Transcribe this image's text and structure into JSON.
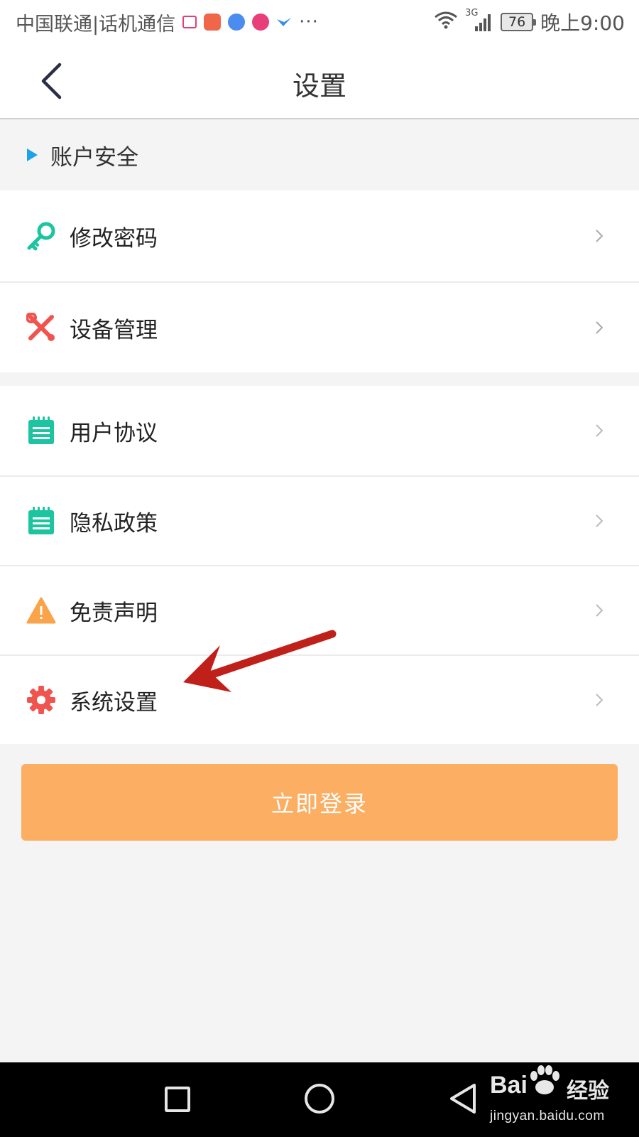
{
  "status_bar": {
    "carrier": "中国联通|话机通信",
    "more": "···",
    "network": "3G",
    "battery": "76",
    "time": "晚上9:00"
  },
  "header": {
    "title": "设置"
  },
  "section": {
    "label": "账户安全"
  },
  "menu_group_1": [
    {
      "label": "修改密码",
      "icon": "key-icon",
      "icon_color": "#1cc4a0"
    },
    {
      "label": "设备管理",
      "icon": "tools-icon",
      "icon_color": "#f0544f"
    }
  ],
  "menu_group_2": [
    {
      "label": "用户协议",
      "icon": "notepad-icon",
      "icon_color": "#1cc4a0"
    },
    {
      "label": "隐私政策",
      "icon": "notepad-icon",
      "icon_color": "#1cc4a0"
    },
    {
      "label": "免责声明",
      "icon": "warning-icon",
      "icon_color": "#f9a44a"
    },
    {
      "label": "系统设置",
      "icon": "gear-icon",
      "icon_color": "#f0544f"
    }
  ],
  "login_button": {
    "label": "立即登录",
    "color": "#fcae62"
  },
  "watermark": {
    "brand": "Bai",
    "brand_suffix": "经验",
    "url": "jingyan.baidu.com"
  },
  "colors": {
    "accent_blue": "#1aa3e8",
    "annotation_arrow": "#c0201a"
  }
}
